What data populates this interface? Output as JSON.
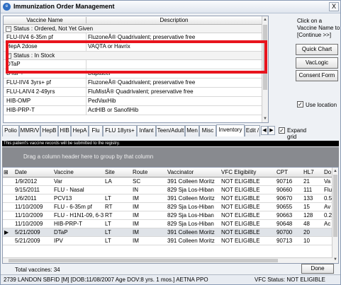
{
  "window": {
    "title": "Immunization Order Management",
    "close_label": "X",
    "icon_label": "e"
  },
  "order_grid": {
    "col_vaccine_name": "Vaccine Name",
    "col_description": "Description",
    "groups": [
      {
        "label": "Status : Ordered, Not Yet Given",
        "rows": [
          [
            "FLU-IIV4 6-35m pf",
            "FluzoneÂ® Quadrivalent; preservative free"
          ],
          [
            "HepA 2dose",
            "VAQTA or Havrix"
          ]
        ]
      },
      {
        "label": "Status : In Stock",
        "rows": [
          [
            "DTaP",
            ""
          ],
          [
            "DTaP+",
            "Daptacel"
          ],
          [
            "FLU-IIV4 3yrs+ pf",
            "FluzoneÂ® Quadrivalent; preservative free"
          ],
          [
            "FLU-LAIV4 2-49yrs",
            "FluMistÂ® Quadrivalent; preservative free"
          ],
          [
            "HIB-OMP",
            "PedVaxHib"
          ],
          [
            "HIB-PRP-T",
            "ActHIB or SanofiHib"
          ]
        ]
      }
    ]
  },
  "side": {
    "hint": "Click on a Vaccine Name to  [Continue >>]",
    "quick_chart": "Quick Chart",
    "vaclogic": "VacLogic",
    "consent_form": "Consent Form",
    "use_location": "Use location",
    "expand_grid": "Expand grid"
  },
  "tabs": [
    "Polio",
    "MMR/V",
    "HepB",
    "HIB",
    "HepA",
    "Flu",
    "FLU 18yrs+",
    "Infant",
    "Teen/Adult",
    "Men",
    "Misc",
    "Inventory",
    "Edit /"
  ],
  "active_tab": "Inventory",
  "notice": "This patient's vaccine records will be submitted to the registry.",
  "group_hint": "Drag a column header here to group by that column",
  "history": {
    "columns": [
      "Date",
      "Vaccine",
      "Site",
      "Route",
      "Vaccinator",
      "VFC Eligibility",
      "CPT",
      "HL7",
      "Do"
    ],
    "rows": [
      [
        "1/9/2012",
        "Var",
        "LA",
        "SC",
        "391 Colleen Moritz",
        "NOT ELIGIBLE",
        "90716",
        "21",
        "Va"
      ],
      [
        "9/15/2011",
        "FLU - Nasal",
        "",
        "IN",
        "829 Sja Los-Hiban",
        "NOT ELIGIBLE",
        "90660",
        "111",
        "Flu"
      ],
      [
        "1/6/2011",
        "PCV13",
        "LT",
        "IM",
        "391 Colleen Moritz",
        "NOT ELIGIBLE",
        "90670",
        "133",
        "0.5"
      ],
      [
        "11/10/2009",
        "FLU - 6-35m pf",
        "RT",
        "IM",
        "829 Sja Los-Hiban",
        "NOT ELIGIBLE",
        "90655",
        "15",
        "Av"
      ],
      [
        "11/10/2009",
        "FLU - H1N1-09, 6-36m",
        "RT",
        "IM",
        "829 Sja Los-Hiban",
        "NOT ELIGIBLE",
        "90663",
        "128",
        "0.2"
      ],
      [
        "11/10/2009",
        "HIB-PRP-T",
        "LT",
        "IM",
        "829 Sja Los-Hiban",
        "NOT ELIGIBLE",
        "90648",
        "48",
        "Ac"
      ],
      [
        "5/21/2009",
        "DTaP",
        "LT",
        "IM",
        "391 Colleen Moritz",
        "NOT ELIGIBLE",
        "90700",
        "20",
        ""
      ],
      [
        "5/21/2009",
        "IPV",
        "LT",
        "IM",
        "391 Colleen Moritz",
        "NOT ELIGIBLE",
        "90713",
        "10",
        ""
      ]
    ],
    "selected_row": 6
  },
  "footer": {
    "total": "Total vaccines: 34",
    "done": "Done",
    "patient": "2739 LANDON SBFID [M] [DOB:11/08/2007 Age DOV:8 yrs. 1 mos.] AETNA PPO",
    "vfc_status": "VFC Status: NOT ELIGIBLE"
  },
  "colors": {
    "highlight": "#e8141d",
    "group_bar": "#888a8f",
    "notice_bg": "#000000"
  }
}
